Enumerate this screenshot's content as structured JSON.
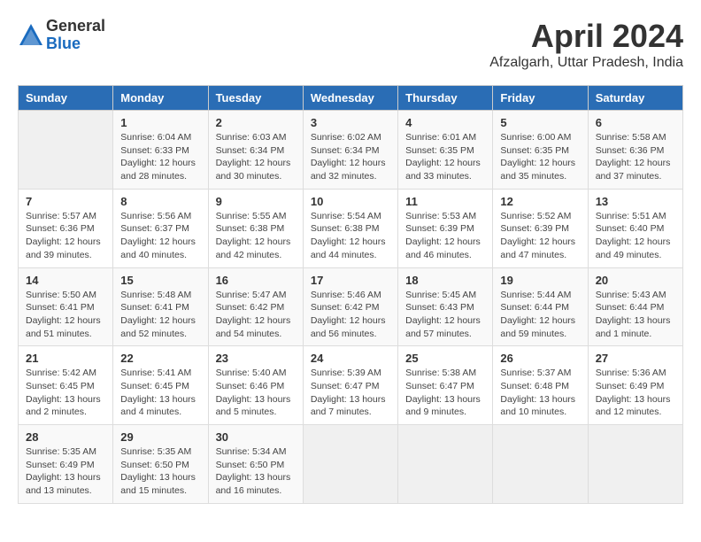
{
  "logo": {
    "general": "General",
    "blue": "Blue"
  },
  "title": {
    "month": "April 2024",
    "location": "Afzalgarh, Uttar Pradesh, India"
  },
  "days_of_week": [
    "Sunday",
    "Monday",
    "Tuesday",
    "Wednesday",
    "Thursday",
    "Friday",
    "Saturday"
  ],
  "weeks": [
    [
      {
        "day": "",
        "info": ""
      },
      {
        "day": "1",
        "info": "Sunrise: 6:04 AM\nSunset: 6:33 PM\nDaylight: 12 hours\nand 28 minutes."
      },
      {
        "day": "2",
        "info": "Sunrise: 6:03 AM\nSunset: 6:34 PM\nDaylight: 12 hours\nand 30 minutes."
      },
      {
        "day": "3",
        "info": "Sunrise: 6:02 AM\nSunset: 6:34 PM\nDaylight: 12 hours\nand 32 minutes."
      },
      {
        "day": "4",
        "info": "Sunrise: 6:01 AM\nSunset: 6:35 PM\nDaylight: 12 hours\nand 33 minutes."
      },
      {
        "day": "5",
        "info": "Sunrise: 6:00 AM\nSunset: 6:35 PM\nDaylight: 12 hours\nand 35 minutes."
      },
      {
        "day": "6",
        "info": "Sunrise: 5:58 AM\nSunset: 6:36 PM\nDaylight: 12 hours\nand 37 minutes."
      }
    ],
    [
      {
        "day": "7",
        "info": "Sunrise: 5:57 AM\nSunset: 6:36 PM\nDaylight: 12 hours\nand 39 minutes."
      },
      {
        "day": "8",
        "info": "Sunrise: 5:56 AM\nSunset: 6:37 PM\nDaylight: 12 hours\nand 40 minutes."
      },
      {
        "day": "9",
        "info": "Sunrise: 5:55 AM\nSunset: 6:38 PM\nDaylight: 12 hours\nand 42 minutes."
      },
      {
        "day": "10",
        "info": "Sunrise: 5:54 AM\nSunset: 6:38 PM\nDaylight: 12 hours\nand 44 minutes."
      },
      {
        "day": "11",
        "info": "Sunrise: 5:53 AM\nSunset: 6:39 PM\nDaylight: 12 hours\nand 46 minutes."
      },
      {
        "day": "12",
        "info": "Sunrise: 5:52 AM\nSunset: 6:39 PM\nDaylight: 12 hours\nand 47 minutes."
      },
      {
        "day": "13",
        "info": "Sunrise: 5:51 AM\nSunset: 6:40 PM\nDaylight: 12 hours\nand 49 minutes."
      }
    ],
    [
      {
        "day": "14",
        "info": "Sunrise: 5:50 AM\nSunset: 6:41 PM\nDaylight: 12 hours\nand 51 minutes."
      },
      {
        "day": "15",
        "info": "Sunrise: 5:48 AM\nSunset: 6:41 PM\nDaylight: 12 hours\nand 52 minutes."
      },
      {
        "day": "16",
        "info": "Sunrise: 5:47 AM\nSunset: 6:42 PM\nDaylight: 12 hours\nand 54 minutes."
      },
      {
        "day": "17",
        "info": "Sunrise: 5:46 AM\nSunset: 6:42 PM\nDaylight: 12 hours\nand 56 minutes."
      },
      {
        "day": "18",
        "info": "Sunrise: 5:45 AM\nSunset: 6:43 PM\nDaylight: 12 hours\nand 57 minutes."
      },
      {
        "day": "19",
        "info": "Sunrise: 5:44 AM\nSunset: 6:44 PM\nDaylight: 12 hours\nand 59 minutes."
      },
      {
        "day": "20",
        "info": "Sunrise: 5:43 AM\nSunset: 6:44 PM\nDaylight: 13 hours\nand 1 minute."
      }
    ],
    [
      {
        "day": "21",
        "info": "Sunrise: 5:42 AM\nSunset: 6:45 PM\nDaylight: 13 hours\nand 2 minutes."
      },
      {
        "day": "22",
        "info": "Sunrise: 5:41 AM\nSunset: 6:45 PM\nDaylight: 13 hours\nand 4 minutes."
      },
      {
        "day": "23",
        "info": "Sunrise: 5:40 AM\nSunset: 6:46 PM\nDaylight: 13 hours\nand 5 minutes."
      },
      {
        "day": "24",
        "info": "Sunrise: 5:39 AM\nSunset: 6:47 PM\nDaylight: 13 hours\nand 7 minutes."
      },
      {
        "day": "25",
        "info": "Sunrise: 5:38 AM\nSunset: 6:47 PM\nDaylight: 13 hours\nand 9 minutes."
      },
      {
        "day": "26",
        "info": "Sunrise: 5:37 AM\nSunset: 6:48 PM\nDaylight: 13 hours\nand 10 minutes."
      },
      {
        "day": "27",
        "info": "Sunrise: 5:36 AM\nSunset: 6:49 PM\nDaylight: 13 hours\nand 12 minutes."
      }
    ],
    [
      {
        "day": "28",
        "info": "Sunrise: 5:35 AM\nSunset: 6:49 PM\nDaylight: 13 hours\nand 13 minutes."
      },
      {
        "day": "29",
        "info": "Sunrise: 5:35 AM\nSunset: 6:50 PM\nDaylight: 13 hours\nand 15 minutes."
      },
      {
        "day": "30",
        "info": "Sunrise: 5:34 AM\nSunset: 6:50 PM\nDaylight: 13 hours\nand 16 minutes."
      },
      {
        "day": "",
        "info": ""
      },
      {
        "day": "",
        "info": ""
      },
      {
        "day": "",
        "info": ""
      },
      {
        "day": "",
        "info": ""
      }
    ]
  ]
}
